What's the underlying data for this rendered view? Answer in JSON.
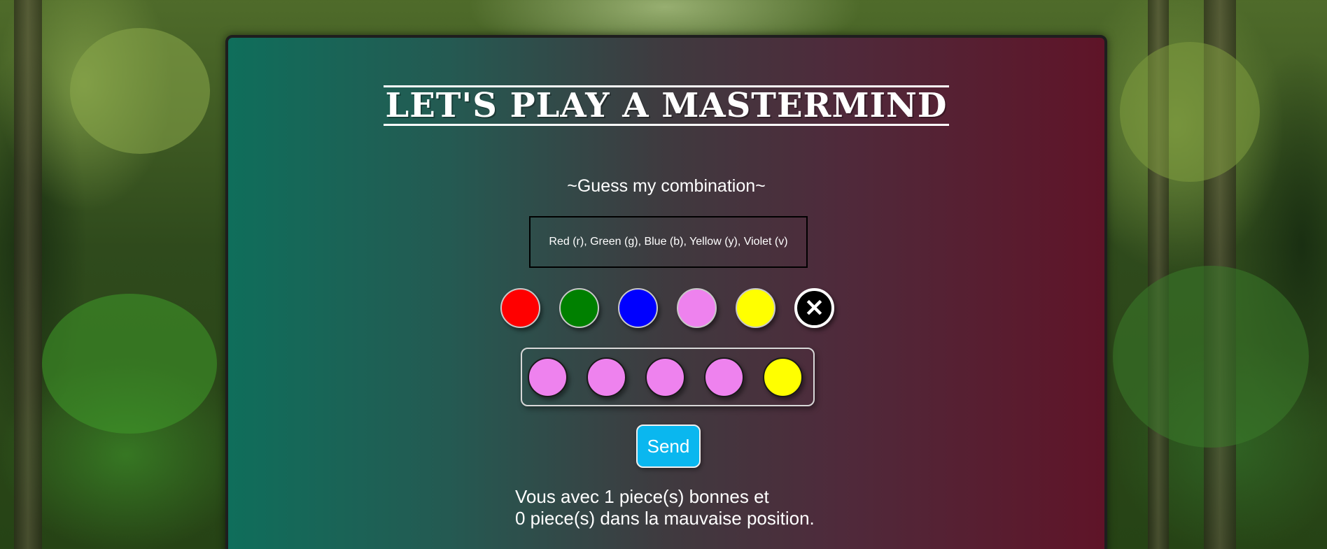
{
  "header": {
    "title": "LET'S PLAY A MASTERMIND",
    "subtitle": "~Guess my combination~"
  },
  "legend": {
    "text": "Red (r), Green (g), Blue (b), Yellow (y), Violet (v)"
  },
  "palette": [
    {
      "name": "red",
      "color": "#ff0000"
    },
    {
      "name": "green",
      "color": "#008000"
    },
    {
      "name": "blue",
      "color": "#0000ff"
    },
    {
      "name": "violet",
      "color": "#ee82ee"
    },
    {
      "name": "yellow",
      "color": "#ffff00"
    }
  ],
  "clear_icon": "close-icon",
  "clear_glyph": "✕",
  "guess": [
    {
      "color": "#ee82ee"
    },
    {
      "color": "#ee82ee"
    },
    {
      "color": "#ee82ee"
    },
    {
      "color": "#ee82ee"
    },
    {
      "color": "#ffff00"
    }
  ],
  "actions": {
    "send_label": "Send"
  },
  "result": {
    "line1": "Vous avec 1 piece(s) bonnes et",
    "line2": "0 piece(s) dans la mauvaise position."
  }
}
